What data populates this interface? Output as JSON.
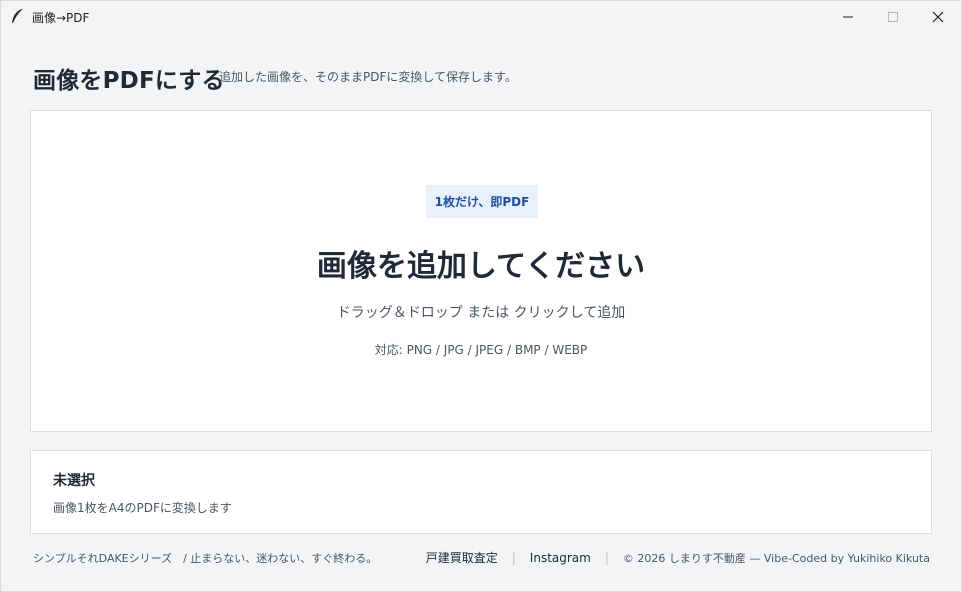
{
  "window": {
    "title": "画像→PDF",
    "app_icon": "feather-icon",
    "controls": {
      "minimize_icon": "minimize-icon",
      "maximize_icon": "maximize-icon",
      "close_icon": "close-icon"
    }
  },
  "header": {
    "title": "画像をPDFにする",
    "subtitle": "追加した画像を、そのままPDFに変換して保存します。"
  },
  "dropzone": {
    "badge": "1枚だけ、即PDF",
    "heading": "画像を追加してください",
    "instruction": "ドラッグ＆ドロップ または クリックして追加",
    "formats": "対応: PNG / JPG / JPEG / BMP / WEBP"
  },
  "status": {
    "title": "未選択",
    "description": "画像1枚をA4のPDFに変換します"
  },
  "footer": {
    "tagline": "シンプルそれDAKEシリーズ　/ 止まらない、迷わない、すぐ終わる。",
    "link_appraisal": "戸建買取査定",
    "link_instagram": "Instagram",
    "separator": "|",
    "copyright": "© 2026 しまりす不動産 — Vibe-Coded by Yukihiko Kikuta"
  },
  "colors": {
    "background": "#f3f4f6",
    "panel": "#ffffff",
    "badge_bg": "#e8f0fc",
    "badge_text": "#1e4f9c",
    "text_primary": "#1f2937",
    "text_secondary": "#4b5563"
  }
}
